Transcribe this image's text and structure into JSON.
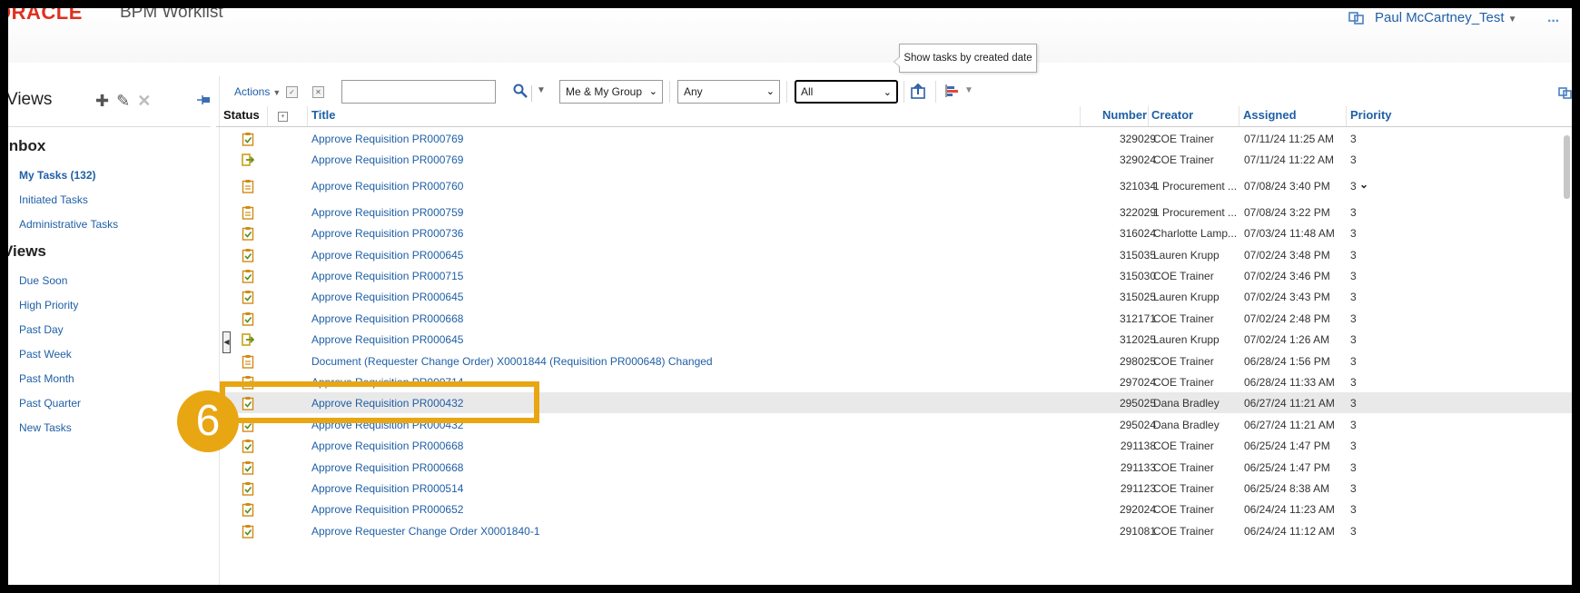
{
  "header": {
    "logo": "ORACLE",
    "app_name": "BPM Worklist",
    "user_name": "Paul McCartney_Test"
  },
  "sidebar": {
    "views_title": "Views",
    "inbox_title": "Inbox",
    "inbox_items": [
      {
        "label": "My Tasks (132)"
      },
      {
        "label": "Initiated Tasks"
      },
      {
        "label": "Administrative Tasks"
      }
    ],
    "views_section_title": "Views",
    "view_items": [
      {
        "label": "Due Soon"
      },
      {
        "label": "High Priority"
      },
      {
        "label": "Past Day"
      },
      {
        "label": "Past Week"
      },
      {
        "label": "Past Month"
      },
      {
        "label": "Past Quarter"
      },
      {
        "label": "New Tasks"
      }
    ]
  },
  "toolbar": {
    "actions_label": "Actions",
    "search_value": "",
    "assignee_filter": "Me & My Group",
    "state_filter": "Any",
    "date_filter": "All",
    "tooltip": "Show tasks by created date"
  },
  "table": {
    "columns": {
      "status": "Status",
      "title": "Title",
      "number": "Number",
      "creator": "Creator",
      "assigned": "Assigned",
      "priority": "Priority"
    },
    "rows": [
      {
        "icon": "clipboard-check-icon",
        "title": "Approve Requisition PR000769",
        "number": "329029",
        "creator": "COE Trainer",
        "assigned": "07/11/24 11:25 AM",
        "priority": "3"
      },
      {
        "icon": "exit-task-icon",
        "title": "Approve Requisition PR000769",
        "number": "329024",
        "creator": "COE Trainer",
        "assigned": "07/11/24 11:22 AM",
        "priority": "3"
      },
      {
        "icon": "clipboard-icon",
        "title": "Approve Requisition PR000760",
        "number": "321034",
        "creator": "1 Procurement ...",
        "assigned": "07/08/24 3:40 PM",
        "priority": "3"
      },
      {
        "icon": "clipboard-icon",
        "title": "Approve Requisition PR000759",
        "number": "322029",
        "creator": "1 Procurement ...",
        "assigned": "07/08/24 3:22 PM",
        "priority": "3"
      },
      {
        "icon": "clipboard-check-icon",
        "title": "Approve Requisition PR000736",
        "number": "316024",
        "creator": "Charlotte Lamp...",
        "assigned": "07/03/24 11:48 AM",
        "priority": "3"
      },
      {
        "icon": "clipboard-check-icon",
        "title": "Approve Requisition PR000645",
        "number": "315035",
        "creator": "Lauren Krupp",
        "assigned": "07/02/24 3:48 PM",
        "priority": "3"
      },
      {
        "icon": "clipboard-check-icon",
        "title": "Approve Requisition PR000715",
        "number": "315030",
        "creator": "COE Trainer",
        "assigned": "07/02/24 3:46 PM",
        "priority": "3"
      },
      {
        "icon": "clipboard-check-icon",
        "title": "Approve Requisition PR000645",
        "number": "315025",
        "creator": "Lauren Krupp",
        "assigned": "07/02/24 3:43 PM",
        "priority": "3"
      },
      {
        "icon": "clipboard-check-icon",
        "title": "Approve Requisition PR000668",
        "number": "312171",
        "creator": "COE Trainer",
        "assigned": "07/02/24 2:48 PM",
        "priority": "3"
      },
      {
        "icon": "exit-task-icon",
        "title": "Approve Requisition PR000645",
        "number": "312025",
        "creator": "Lauren Krupp",
        "assigned": "07/02/24 1:26 AM",
        "priority": "3"
      },
      {
        "icon": "clipboard-icon",
        "title": "Document (Requester Change Order) X0001844 (Requisition PR000648) Changed",
        "number": "298025",
        "creator": "COE Trainer",
        "assigned": "06/28/24 1:56 PM",
        "priority": "3"
      },
      {
        "icon": "clipboard-check-icon",
        "title": "Approve Requisition PR000714",
        "number": "297024",
        "creator": "COE Trainer",
        "assigned": "06/28/24 11:33 AM",
        "priority": "3"
      },
      {
        "icon": "clipboard-check-icon",
        "title": "Approve Requisition PR000432",
        "number": "295025",
        "creator": "Dana Bradley",
        "assigned": "06/27/24 11:21 AM",
        "priority": "3"
      },
      {
        "icon": "clipboard-check-icon",
        "title": "Approve Requisition PR000432",
        "number": "295024",
        "creator": "Dana Bradley",
        "assigned": "06/27/24 11:21 AM",
        "priority": "3"
      },
      {
        "icon": "clipboard-check-icon",
        "title": "Approve Requisition PR000668",
        "number": "291138",
        "creator": "COE Trainer",
        "assigned": "06/25/24 1:47 PM",
        "priority": "3"
      },
      {
        "icon": "clipboard-check-icon",
        "title": "Approve Requisition PR000668",
        "number": "291133",
        "creator": "COE Trainer",
        "assigned": "06/25/24 1:47 PM",
        "priority": "3"
      },
      {
        "icon": "clipboard-check-icon",
        "title": "Approve Requisition PR000514",
        "number": "291123",
        "creator": "COE Trainer",
        "assigned": "06/25/24 8:38 AM",
        "priority": "3"
      },
      {
        "icon": "clipboard-check-icon",
        "title": "Approve Requisition PR000652",
        "number": "292024",
        "creator": "COE Trainer",
        "assigned": "06/24/24 11:23 AM",
        "priority": "3"
      },
      {
        "icon": "clipboard-check-icon",
        "title": "Approve Requester Change Order X0001840-1",
        "number": "291081",
        "creator": "COE Trainer",
        "assigned": "06/24/24 11:12 AM",
        "priority": "3"
      }
    ]
  },
  "annotation": {
    "step_number": "6"
  },
  "colors": {
    "link": "#1f5fa6",
    "accent": "#e8a613",
    "oracle_red": "#e0301e",
    "selected_row": "#e9e9ea"
  }
}
